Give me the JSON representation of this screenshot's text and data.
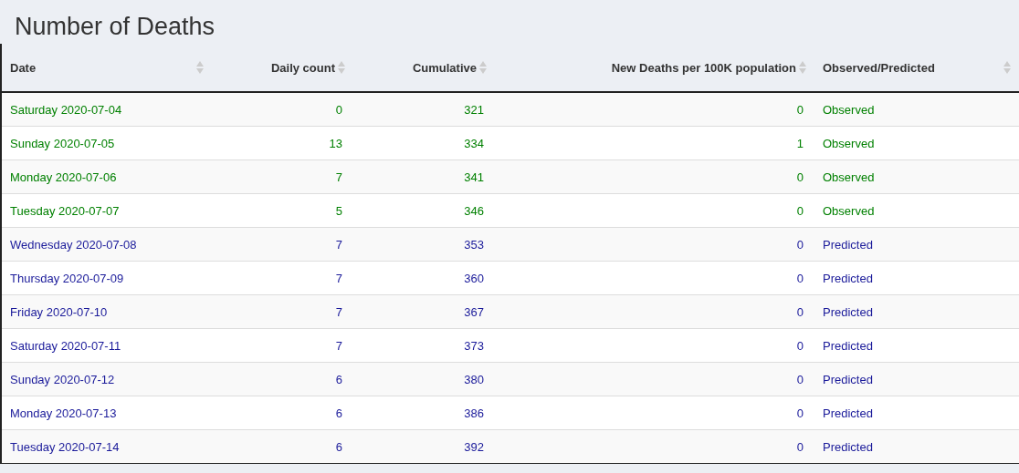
{
  "title": "Number of Deaths",
  "table": {
    "columns": [
      {
        "label": "Date",
        "kind": "text"
      },
      {
        "label": "Daily count",
        "kind": "number"
      },
      {
        "label": "Cumulative",
        "kind": "number"
      },
      {
        "label": "New Deaths per 100K population",
        "kind": "number"
      },
      {
        "label": "Observed/Predicted",
        "kind": "text"
      }
    ],
    "rows": [
      {
        "color": "#008000",
        "cells": [
          "Saturday 2020-07-04",
          "0",
          "321",
          "0",
          "Observed"
        ]
      },
      {
        "color": "#008000",
        "cells": [
          "Sunday 2020-07-05",
          "13",
          "334",
          "1",
          "Observed"
        ]
      },
      {
        "color": "#008000",
        "cells": [
          "Monday 2020-07-06",
          "7",
          "341",
          "0",
          "Observed"
        ]
      },
      {
        "color": "#008000",
        "cells": [
          "Tuesday 2020-07-07",
          "5",
          "346",
          "0",
          "Observed"
        ]
      },
      {
        "color": "#1a1a9a",
        "cells": [
          "Wednesday 2020-07-08",
          "7",
          "353",
          "0",
          "Predicted"
        ]
      },
      {
        "color": "#1a1a9a",
        "cells": [
          "Thursday 2020-07-09",
          "7",
          "360",
          "0",
          "Predicted"
        ]
      },
      {
        "color": "#1a1a9a",
        "cells": [
          "Friday 2020-07-10",
          "7",
          "367",
          "0",
          "Predicted"
        ]
      },
      {
        "color": "#1a1a9a",
        "cells": [
          "Saturday 2020-07-11",
          "7",
          "373",
          "0",
          "Predicted"
        ]
      },
      {
        "color": "#1a1a9a",
        "cells": [
          "Sunday 2020-07-12",
          "6",
          "380",
          "0",
          "Predicted"
        ]
      },
      {
        "color": "#1a1a9a",
        "cells": [
          "Monday 2020-07-13",
          "6",
          "386",
          "0",
          "Predicted"
        ]
      },
      {
        "color": "#1a1a9a",
        "cells": [
          "Tuesday 2020-07-14",
          "6",
          "392",
          "0",
          "Predicted"
        ]
      }
    ]
  }
}
